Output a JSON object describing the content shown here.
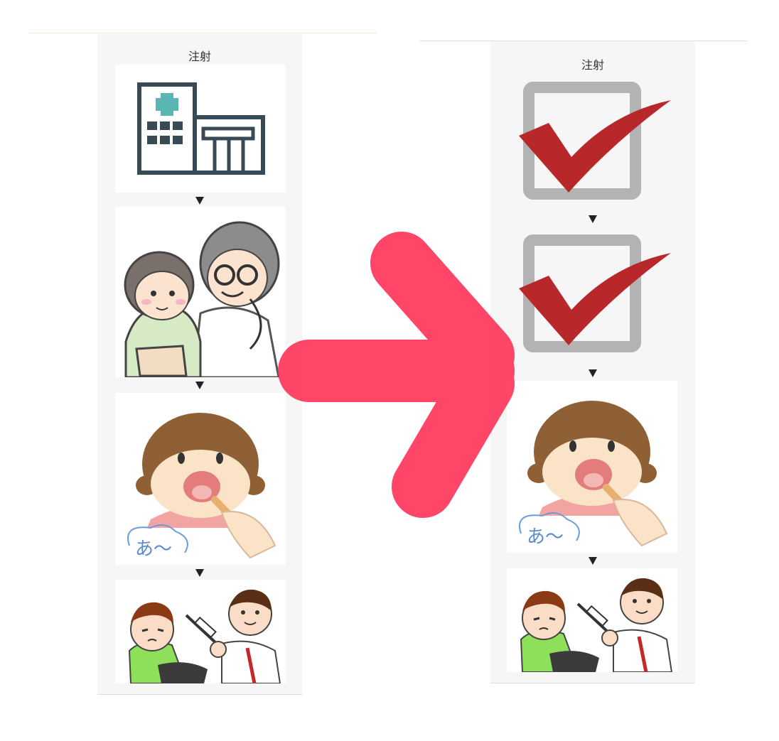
{
  "left_panel": {
    "title": "注射",
    "steps": [
      {
        "icon": "hospital-building-icon"
      },
      {
        "icon": "doctor-with-child-stethoscope-icon"
      },
      {
        "icon": "throat-check-girl-icon",
        "speech": "あ～"
      },
      {
        "icon": "injection-boy-doctor-icon"
      }
    ]
  },
  "right_panel": {
    "title": "注射",
    "steps": [
      {
        "icon": "red-checkmark-icon"
      },
      {
        "icon": "red-checkmark-icon"
      },
      {
        "icon": "throat-check-girl-icon",
        "speech": "あ～"
      },
      {
        "icon": "injection-boy-doctor-icon"
      }
    ]
  },
  "transition_arrow": {
    "icon": "right-arrow-icon",
    "color": "#ff2d55"
  },
  "colors": {
    "hospital": "#394a57",
    "cross": "#5ab6b3",
    "check": "#b8282a"
  }
}
